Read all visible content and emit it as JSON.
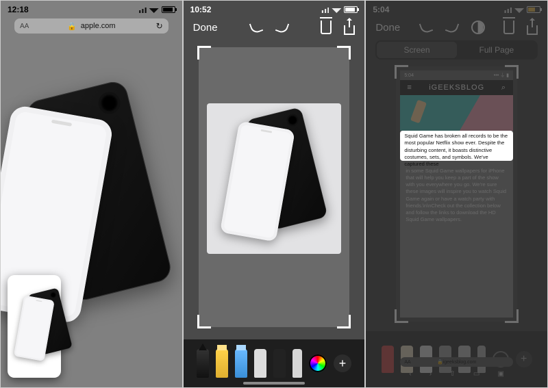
{
  "panel1": {
    "time": "12:18",
    "url": "apple.com",
    "aa_label": "AA",
    "reload_icon": "↻"
  },
  "panel2": {
    "time": "10:52",
    "done_label": "Done",
    "tools": {
      "plus_label": "+"
    }
  },
  "panel3": {
    "time": "5:04",
    "done_label": "Done",
    "segmented": {
      "screen": "Screen",
      "fullpage": "Full Page"
    },
    "webpage": {
      "time": "5:04",
      "brand": "iGEEKSBLOG",
      "url": "igeeksblog.com",
      "aa_label": "AA",
      "highlight_text": "Squid Game has broken all records to be the most popular Netflix show ever. Despite the disturbing content, it boasts distinctive costumes, sets, and symbols. We've captured these",
      "body_rest": "in some Squid Game wallpapers for iPhone that will help you keep a part of the show with you everywhere you go. We're sure these images will inspire you to watch Squid Game again or have a watch party with friends.\\n\\nCheck out the collection below and follow the links to download the HD Squid Game wallpapers."
    },
    "tools": {
      "plus_label": "+"
    }
  }
}
